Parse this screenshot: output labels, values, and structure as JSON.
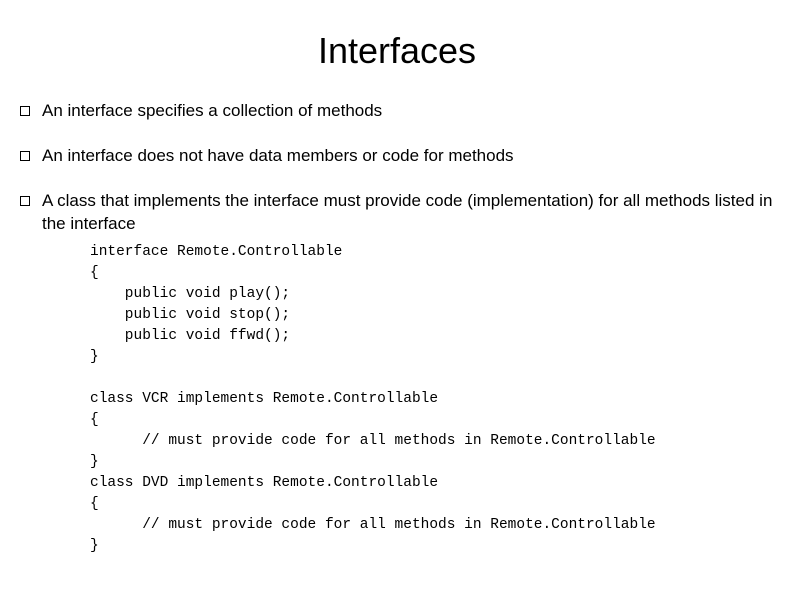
{
  "title": "Interfaces",
  "bullets": [
    "An interface specifies a collection of methods",
    "An interface does not have data members or code for methods",
    "A class that implements the interface must provide code (implementation) for all methods listed in the interface"
  ],
  "code": "interface Remote.Controllable\n{\n    public void play();\n    public void stop();\n    public void ffwd();\n}\n\nclass VCR implements Remote.Controllable\n{\n      // must provide code for all methods in Remote.Controllable\n}\nclass DVD implements Remote.Controllable\n{\n      // must provide code for all methods in Remote.Controllable\n}"
}
